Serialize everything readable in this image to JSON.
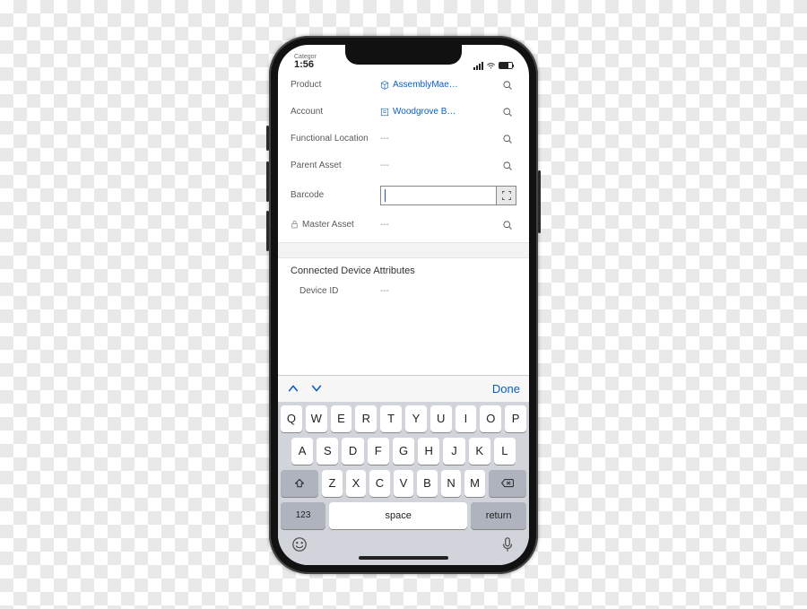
{
  "status": {
    "category": "Categor",
    "time": "1:56"
  },
  "form": {
    "product": {
      "label": "Product",
      "value": "AssemblyMae…"
    },
    "account": {
      "label": "Account",
      "value": "Woodgrove B…"
    },
    "location": {
      "label": "Functional Location",
      "value": "---"
    },
    "parent": {
      "label": "Parent Asset",
      "value": "---"
    },
    "barcode": {
      "label": "Barcode"
    },
    "master": {
      "label": "Master Asset",
      "value": "---"
    }
  },
  "section": {
    "title": "Connected Device Attributes",
    "device_id": {
      "label": "Device ID",
      "value": "---"
    }
  },
  "kb": {
    "done": "Done",
    "r1": [
      "Q",
      "W",
      "E",
      "R",
      "T",
      "Y",
      "U",
      "I",
      "O",
      "P"
    ],
    "r2": [
      "A",
      "S",
      "D",
      "F",
      "G",
      "H",
      "J",
      "K",
      "L"
    ],
    "r3": [
      "Z",
      "X",
      "C",
      "V",
      "B",
      "N",
      "M"
    ],
    "num": "123",
    "space": "space",
    "ret": "return"
  }
}
